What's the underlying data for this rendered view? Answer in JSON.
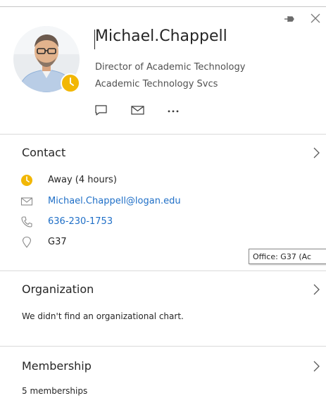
{
  "person": {
    "name": "Michael.Chappell",
    "title": "Director of Academic Technology",
    "department": "Academic Technology Svcs",
    "presence_color": "#f2b705"
  },
  "header_icons": [
    "pin-icon",
    "close-icon"
  ],
  "actions": [
    "chat-icon",
    "mail-icon",
    "more-icon"
  ],
  "contact": {
    "heading": "Contact",
    "status": "Away (4 hours)",
    "email": "Michael.Chappell@logan.edu",
    "phone": "636-230-1753",
    "office": "G37",
    "tooltip": "Office: G37  (Ac"
  },
  "organization": {
    "heading": "Organization",
    "text": "We didn't find an organizational chart."
  },
  "membership": {
    "heading": "Membership",
    "text": "5 memberships"
  },
  "colors": {
    "link": "#1f6fc7",
    "away": "#f2b705",
    "divider": "#dadada"
  }
}
